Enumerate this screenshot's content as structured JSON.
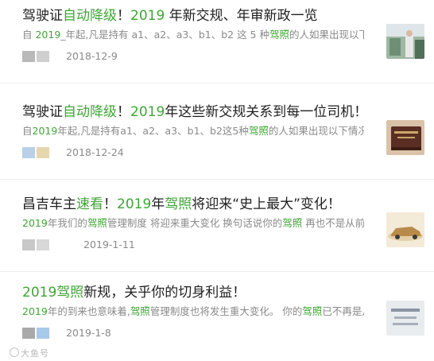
{
  "articles": [
    {
      "title_parts": [
        {
          "text": "驾驶证",
          "hl": false
        },
        {
          "text": "自动降级",
          "hl": true
        },
        {
          "text": "！",
          "hl": false
        },
        {
          "text": "2019",
          "hl": true
        },
        {
          "text": " 年新交规、年审新政一览",
          "hl": false
        }
      ],
      "summary_parts": [
        {
          "text": "自 ",
          "hl": false
        },
        {
          "text": "2019",
          "hl": true
        },
        {
          "text": "_年起,凡是持有 a1、a2、a3、b1、b2 这 5 种",
          "hl": false
        },
        {
          "text": "驾照",
          "hl": true
        },
        {
          "text": "的人如果出现以下...",
          "hl": false
        }
      ],
      "date": "2018-12-9",
      "thumbnail": "photo-thumbnail",
      "avatar_colors": [
        "#b9b9b9",
        "#cfcfcf"
      ]
    },
    {
      "title_parts": [
        {
          "text": "驾驶证",
          "hl": false
        },
        {
          "text": "自动降级",
          "hl": true
        },
        {
          "text": "！",
          "hl": false
        },
        {
          "text": "2019",
          "hl": true
        },
        {
          "text": "年这些新交规关系到每一位司机！",
          "hl": false
        }
      ],
      "summary_parts": [
        {
          "text": "自",
          "hl": false
        },
        {
          "text": "2019",
          "hl": true
        },
        {
          "text": "年起,凡是持有a1、a2、a3、b1、b2这5种",
          "hl": false
        },
        {
          "text": "驾照",
          "hl": true
        },
        {
          "text": "的人如果出现以下情况...",
          "hl": false
        }
      ],
      "date": "2018-12-24",
      "thumbnail": "license-thumbnail",
      "avatar_colors": [
        "#b9d0e8",
        "#e6d6b0"
      ]
    },
    {
      "title_parts": [
        {
          "text": "昌吉车主",
          "hl": false
        },
        {
          "text": "速看",
          "hl": true
        },
        {
          "text": "！",
          "hl": false
        },
        {
          "text": "2019",
          "hl": true
        },
        {
          "text": "年",
          "hl": false
        },
        {
          "text": "驾照",
          "hl": true
        },
        {
          "text": "将迎来“史上最大”变化！",
          "hl": false
        }
      ],
      "summary_parts": [
        {
          "text": "2019",
          "hl": true
        },
        {
          "text": "年我们的",
          "hl": false
        },
        {
          "text": "驾照",
          "hl": true
        },
        {
          "text": "管理制度 将迎来重大变化 换句话说你的",
          "hl": false
        },
        {
          "text": "驾照",
          "hl": true
        },
        {
          "text": " 再也不是从前...",
          "hl": false
        }
      ],
      "date": "2019-1-11",
      "thumbnail": "car-thumbnail",
      "avatar_colors": [
        "#c8c8c8",
        "#d8d8d8"
      ]
    },
    {
      "title_parts": [
        {
          "text": "2019驾照",
          "hl": true
        },
        {
          "text": "新规，关乎你的切身利益！",
          "hl": false
        }
      ],
      "summary_parts": [
        {
          "text": "2019",
          "hl": true
        },
        {
          "text": "年的到来也意味着,",
          "hl": false
        },
        {
          "text": "驾照",
          "hl": true
        },
        {
          "text": "管理制度也将发生重大变化。 你的",
          "hl": false
        },
        {
          "text": "驾照",
          "hl": true
        },
        {
          "text": "已不再是从...",
          "hl": false
        }
      ],
      "date": "2019-1-8",
      "thumbnail": "text-image-thumbnail",
      "avatar_colors": [
        "#a9a9a9",
        "#a9c9ea"
      ]
    }
  ],
  "watermark": "大鱼号",
  "colors": {
    "highlight": "#3fa535",
    "meta": "#8a8a8a",
    "title": "#1f1f1f"
  }
}
